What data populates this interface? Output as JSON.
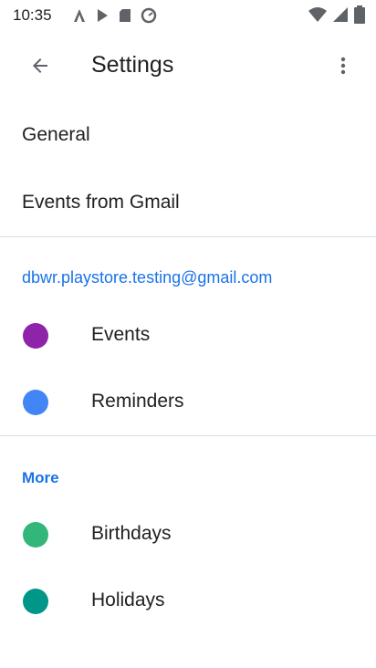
{
  "status": {
    "time": "10:35",
    "left_icons": [
      "app-a-icon",
      "app-b-icon",
      "sd-card-icon",
      "sync-icon"
    ],
    "right_icons": [
      "wifi-icon",
      "signal-icon",
      "battery-icon"
    ]
  },
  "app_bar": {
    "title": "Settings",
    "back_icon": "arrow-back-icon",
    "more_icon": "more-vert-icon"
  },
  "list": {
    "general": "General",
    "events_from_gmail": "Events from Gmail",
    "account": "dbwr.playstore.testing@gmail.com",
    "account_calendars": [
      {
        "label": "Events",
        "color": "#8e24aa"
      },
      {
        "label": "Reminders",
        "color": "#4285f4"
      }
    ],
    "more_header": "More",
    "more_calendars": [
      {
        "label": "Birthdays",
        "color": "#33b679"
      },
      {
        "label": "Holidays",
        "color": "#009688"
      }
    ]
  }
}
